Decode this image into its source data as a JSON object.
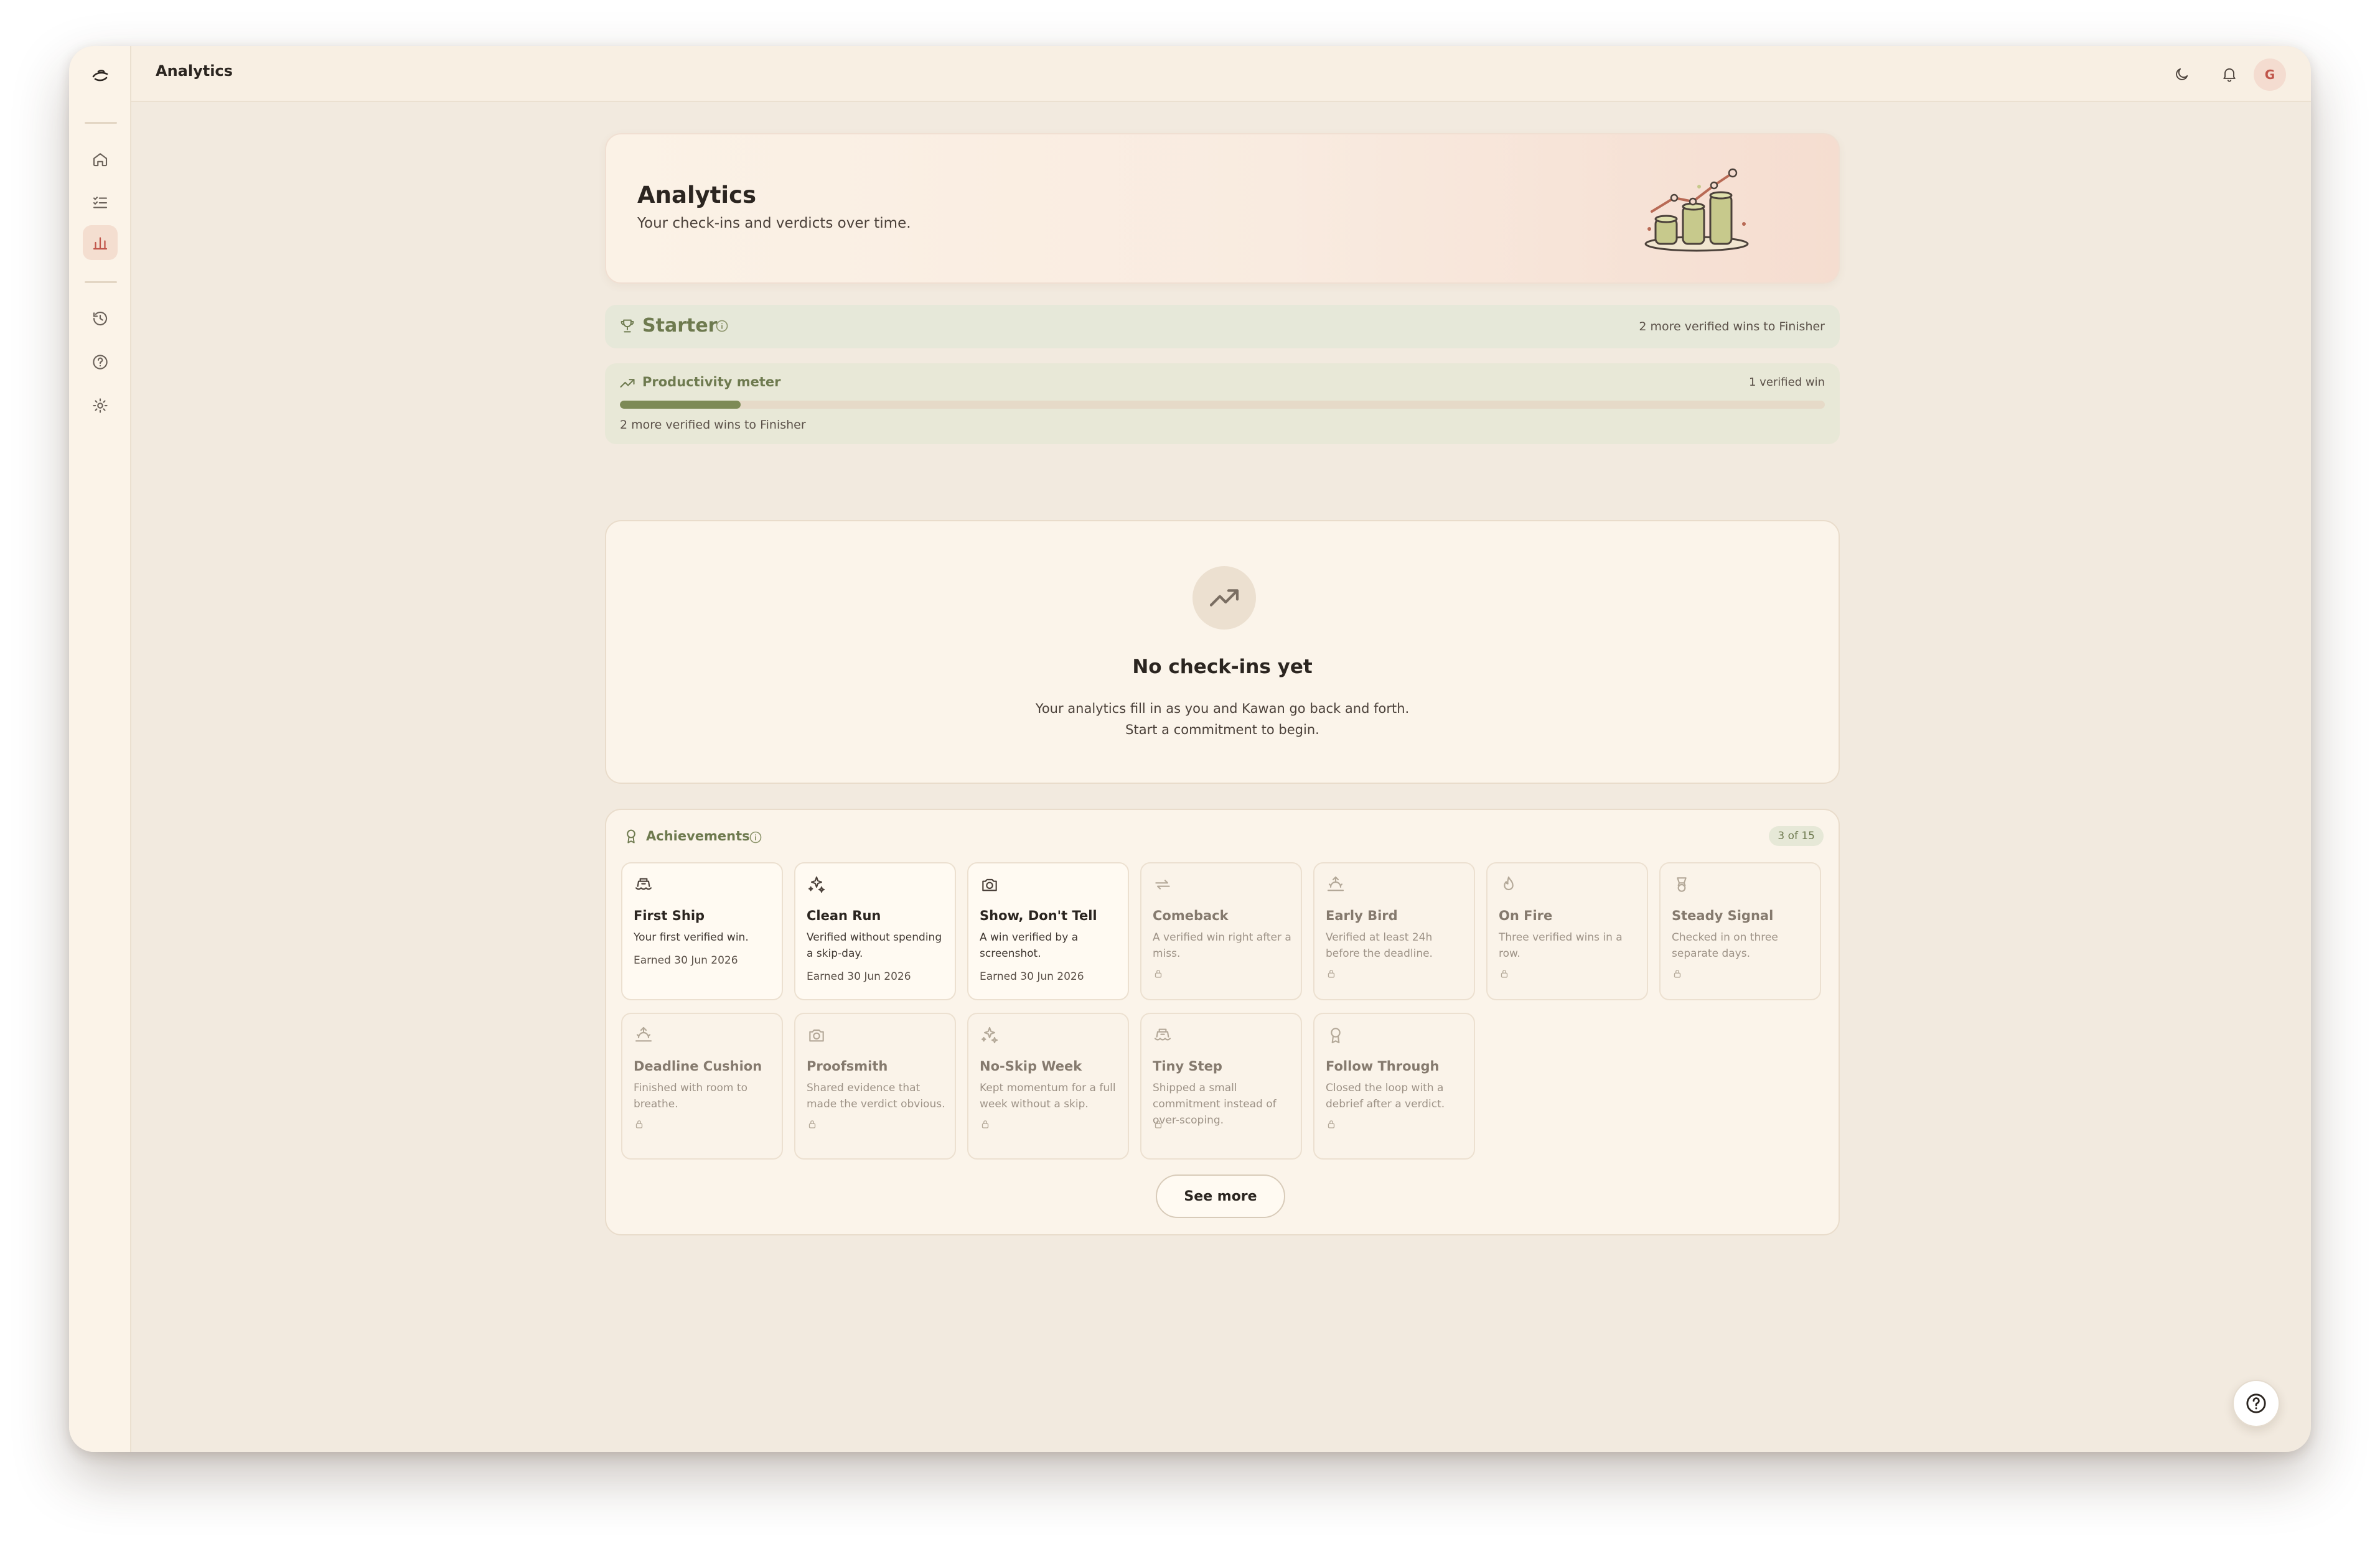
{
  "header": {
    "title": "Analytics",
    "avatar_initial": "G"
  },
  "sidebar": {
    "items": [
      {
        "name": "home",
        "icon": "home-icon"
      },
      {
        "name": "commitments",
        "icon": "list-check-icon"
      },
      {
        "name": "analytics",
        "icon": "bar-chart-icon",
        "active": true
      },
      {
        "name": "history",
        "icon": "history-icon"
      },
      {
        "name": "help",
        "icon": "help-circle-icon"
      },
      {
        "name": "settings",
        "icon": "gear-icon"
      }
    ]
  },
  "hero": {
    "title": "Analytics",
    "subtitle": "Your check-ins and verdicts over time."
  },
  "tier": {
    "name": "Starter",
    "note": "2 more verified wins to Finisher"
  },
  "meter": {
    "label": "Productivity meter",
    "count": "1 verified win",
    "progress": 0.1,
    "note": "2 more verified wins to Finisher"
  },
  "empty": {
    "title": "No check-ins yet",
    "line1": "Your analytics fill in as you and Kawan go back and forth.",
    "line2": "Start a commitment to begin."
  },
  "achievements": {
    "title": "Achievements",
    "count": "3 of 15",
    "see_more": "See more",
    "items": [
      {
        "name": "First Ship",
        "desc": "Your first verified win.",
        "earned": "Earned 30 Jun 2026",
        "icon": "ship-icon",
        "locked": false
      },
      {
        "name": "Clean Run",
        "desc": "Verified without spending a skip-day.",
        "earned": "Earned 30 Jun 2026",
        "icon": "sparkles-icon",
        "locked": false
      },
      {
        "name": "Show, Don't Tell",
        "desc": "A win verified by a screenshot.",
        "earned": "Earned 30 Jun 2026",
        "icon": "camera-icon",
        "locked": false
      },
      {
        "name": "Comeback",
        "desc": "A verified win right after a miss.",
        "icon": "repeat-icon",
        "locked": true
      },
      {
        "name": "Early Bird",
        "desc": "Verified at least 24h before the deadline.",
        "icon": "sunrise-icon",
        "locked": true
      },
      {
        "name": "On Fire",
        "desc": "Three verified wins in a row.",
        "icon": "flame-icon",
        "locked": true
      },
      {
        "name": "Steady Signal",
        "desc": "Checked in on three separate days.",
        "icon": "badge-icon",
        "locked": true
      },
      {
        "name": "Deadline Cushion",
        "desc": "Finished with room to breathe.",
        "icon": "sunrise-icon",
        "locked": true
      },
      {
        "name": "Proofsmith",
        "desc": "Shared evidence that made the verdict obvious.",
        "icon": "camera-icon",
        "locked": true
      },
      {
        "name": "No-Skip Week",
        "desc": "Kept momentum for a full week without a skip.",
        "icon": "sparkles-icon",
        "locked": true
      },
      {
        "name": "Tiny Step",
        "desc": "Shipped a small commitment instead of over-scoping.",
        "icon": "ship-icon",
        "locked": true
      },
      {
        "name": "Follow Through",
        "desc": "Closed the loop with a debrief after a verdict.",
        "icon": "award-icon",
        "locked": true
      }
    ]
  },
  "colors": {
    "accent_green": "#6e7a4f",
    "active_nav": "#f4ded0",
    "avatar_text": "#c0554a"
  }
}
